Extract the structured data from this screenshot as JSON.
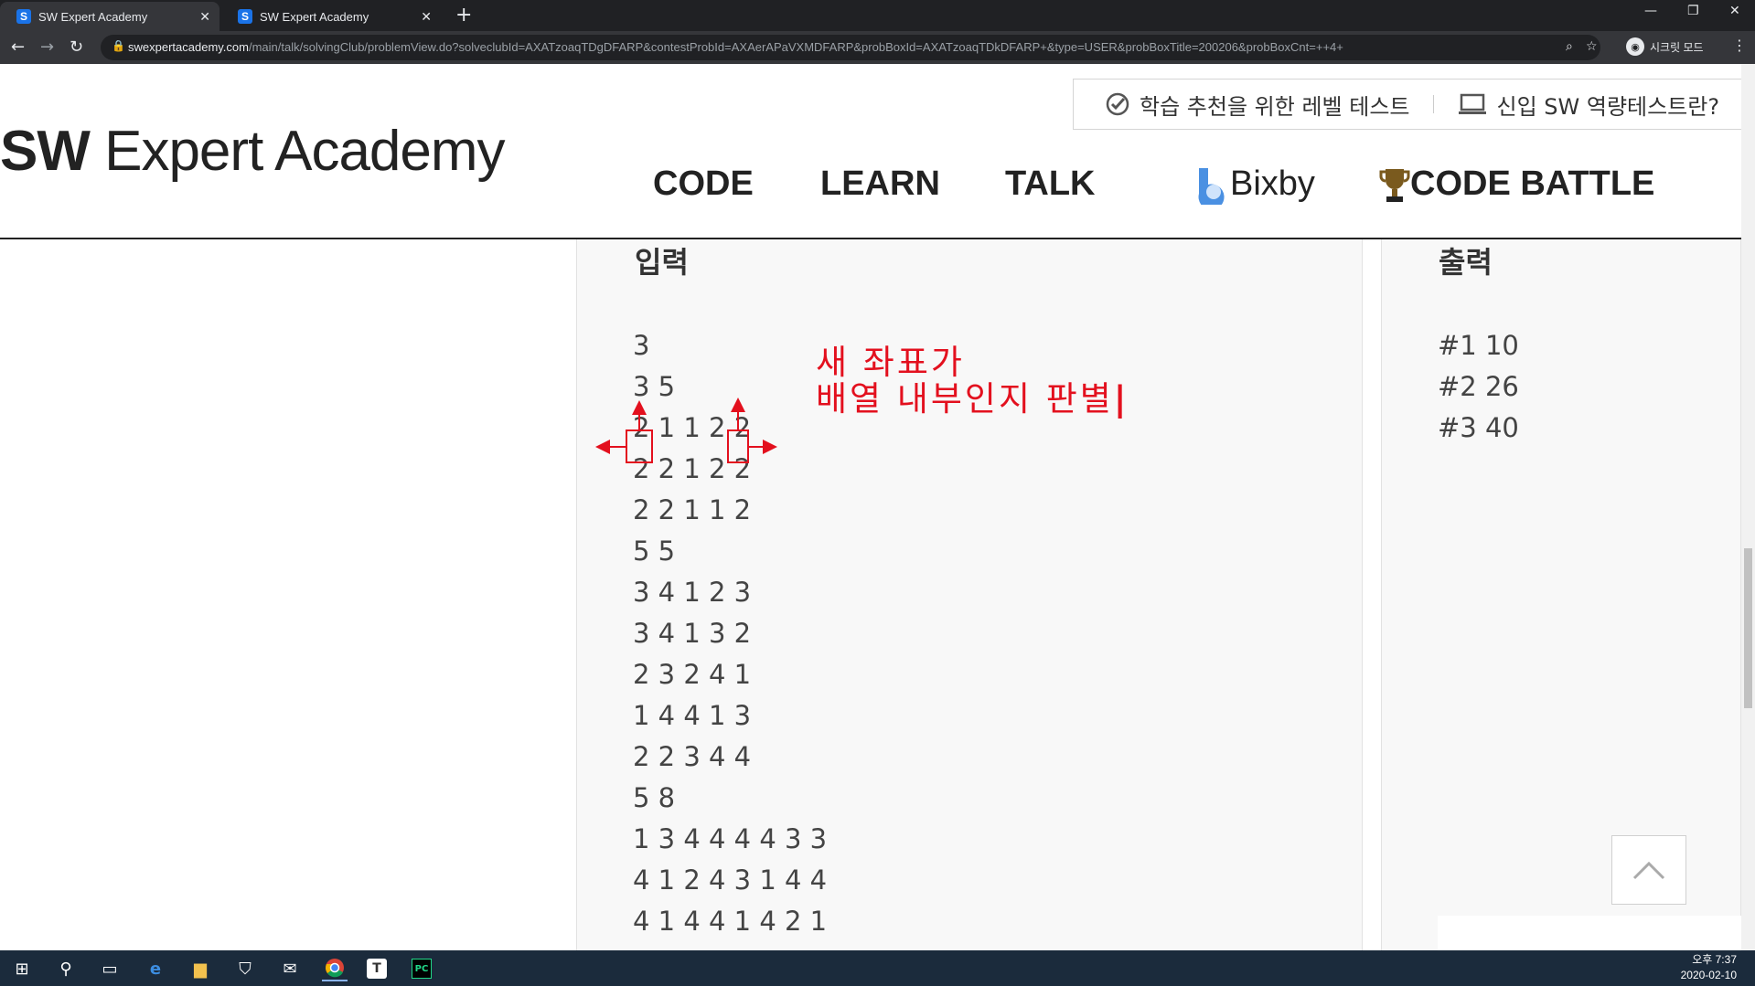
{
  "browser": {
    "tabs": [
      {
        "title": "SW Expert Academy",
        "active": true
      },
      {
        "title": "SW Expert Academy",
        "active": false
      }
    ],
    "favicon_letter": "S",
    "url_host": "swexpertacademy.com",
    "url_path": "/main/talk/solvingClub/problemView.do?solveclubId=AXATzoaqTDgDFARP&contestProbId=AXAerAPaVXMDFARP&probBoxId=AXATzoaqTDkDFARP+&type=USER&probBoxTitle=200206&probBoxCnt=++4+",
    "profile_label": "시크릿 모드"
  },
  "site": {
    "logo_bold": "SW",
    "logo_rest": " Expert Academy",
    "top_links": [
      "학습 추천을 위한 레벨 테스트",
      "신입 SW 역량테스트란?"
    ],
    "nav": [
      "CODE",
      "LEARN",
      "TALK",
      "Bixby",
      "CODE BATTLE"
    ]
  },
  "input_panel": {
    "title": "입력",
    "lines": [
      "3",
      "3 5",
      "2 1 1 2 2",
      "2 2 1 2 2",
      "2 2 1 1 2",
      "5 5",
      "3 4 1 2 3",
      "3 4 1 3 2",
      "2 3 2 4 1",
      "1 4 4 1 3",
      "2 2 3 4 4",
      "5 8",
      "1 3 4 4 4 4 3 3",
      "4 1 2 4 3 1 4 4",
      "4 1 4 4 1 4 2 1"
    ]
  },
  "output_panel": {
    "title": "출력",
    "lines": [
      "#1 10",
      "#2 26",
      "#3 40"
    ]
  },
  "annotation": {
    "line1": "새 좌표가",
    "line2": "배열 내부인지 판별",
    "color": "#e3101e"
  },
  "taskbar": {
    "time": "오후 7:37",
    "date": "2020-02-10"
  }
}
